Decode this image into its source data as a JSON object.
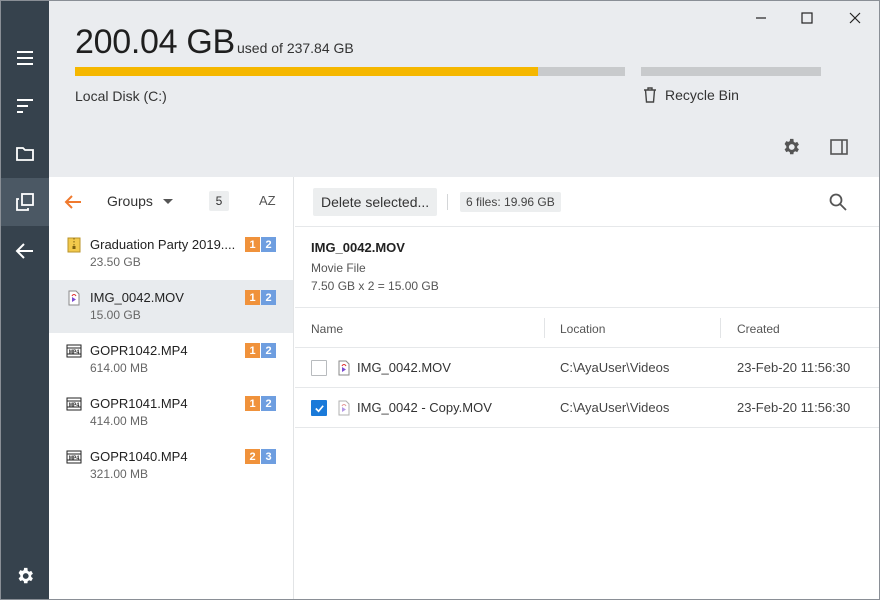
{
  "header": {
    "used_value": "200.04 GB",
    "used_of": "used of 237.84 GB",
    "disk_label": "Local Disk (C:)",
    "disk_used_fraction": 0.841,
    "recycle_label": "Recycle Bin",
    "recycle_used_fraction": 0
  },
  "nav": {
    "items": [
      "menu-icon",
      "sort-icon",
      "folder-icon",
      "duplicates-icon",
      "back-icon"
    ],
    "settings_icon": "gear-icon"
  },
  "list": {
    "groups_label": "Groups",
    "count": "5",
    "sort_label": "AZ",
    "items": [
      {
        "name": "Graduation Party 2019....",
        "size": "23.50 GB",
        "icon": "zip-icon",
        "badges": [
          "1",
          "2"
        ]
      },
      {
        "name": "IMG_0042.MOV",
        "size": "15.00 GB",
        "icon": "video-file-icon",
        "badges": [
          "1",
          "2"
        ]
      },
      {
        "name": "GOPR1042.MP4",
        "size": "614.00 MB",
        "icon": "mp4-file-icon",
        "badges": [
          "1",
          "2"
        ]
      },
      {
        "name": "GOPR1041.MP4",
        "size": "414.00 MB",
        "icon": "mp4-file-icon",
        "badges": [
          "1",
          "2"
        ]
      },
      {
        "name": "GOPR1040.MP4",
        "size": "321.00 MB",
        "icon": "mp4-file-icon",
        "badges": [
          "2",
          "3"
        ]
      }
    ]
  },
  "detail": {
    "delete_label": "Delete selected...",
    "files_summary": "6 files: 19.96 GB",
    "file_name": "IMG_0042.MOV",
    "file_type": "Movie File",
    "file_size": "7.50 GB x 2 = 15.00 GB",
    "columns": [
      "Name",
      "Location",
      "Created"
    ],
    "rows": [
      {
        "name": "IMG_0042.MOV",
        "location": "C:\\AyaUser\\Videos",
        "created": "23-Feb-20 11:56:30",
        "checked": false
      },
      {
        "name": "IMG_0042 - Copy.MOV",
        "location": "C:\\AyaUser\\Videos",
        "created": "23-Feb-20 11:56:30",
        "checked": true
      }
    ]
  },
  "colors": {
    "rail": "#36424d",
    "accent_bar": "#f5b700",
    "badge_orange": "#f0923b",
    "badge_blue": "#6e9ee0",
    "checkbox": "#1a7ad9",
    "back_arrow": "#f07a2e"
  }
}
